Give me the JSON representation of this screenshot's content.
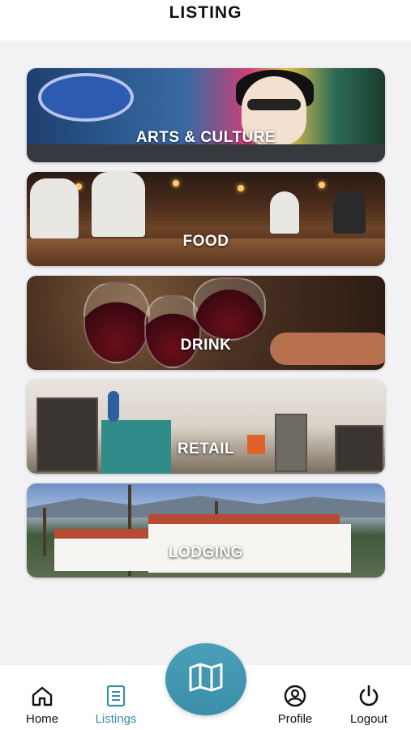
{
  "header": {
    "title": "LISTING"
  },
  "categories": [
    {
      "label": "ARTS & CULTURE"
    },
    {
      "label": "FOOD"
    },
    {
      "label": "DRINK"
    },
    {
      "label": "RETAIL"
    },
    {
      "label": "LODGING"
    }
  ],
  "tabbar": {
    "home": "Home",
    "listings": "Listings",
    "profile": "Profile",
    "logout": "Logout"
  },
  "colors": {
    "accent": "#3a8ea8",
    "background": "#f2f2f4"
  },
  "icons": [
    "home-icon",
    "listings-icon",
    "map-icon",
    "profile-icon",
    "power-icon"
  ]
}
